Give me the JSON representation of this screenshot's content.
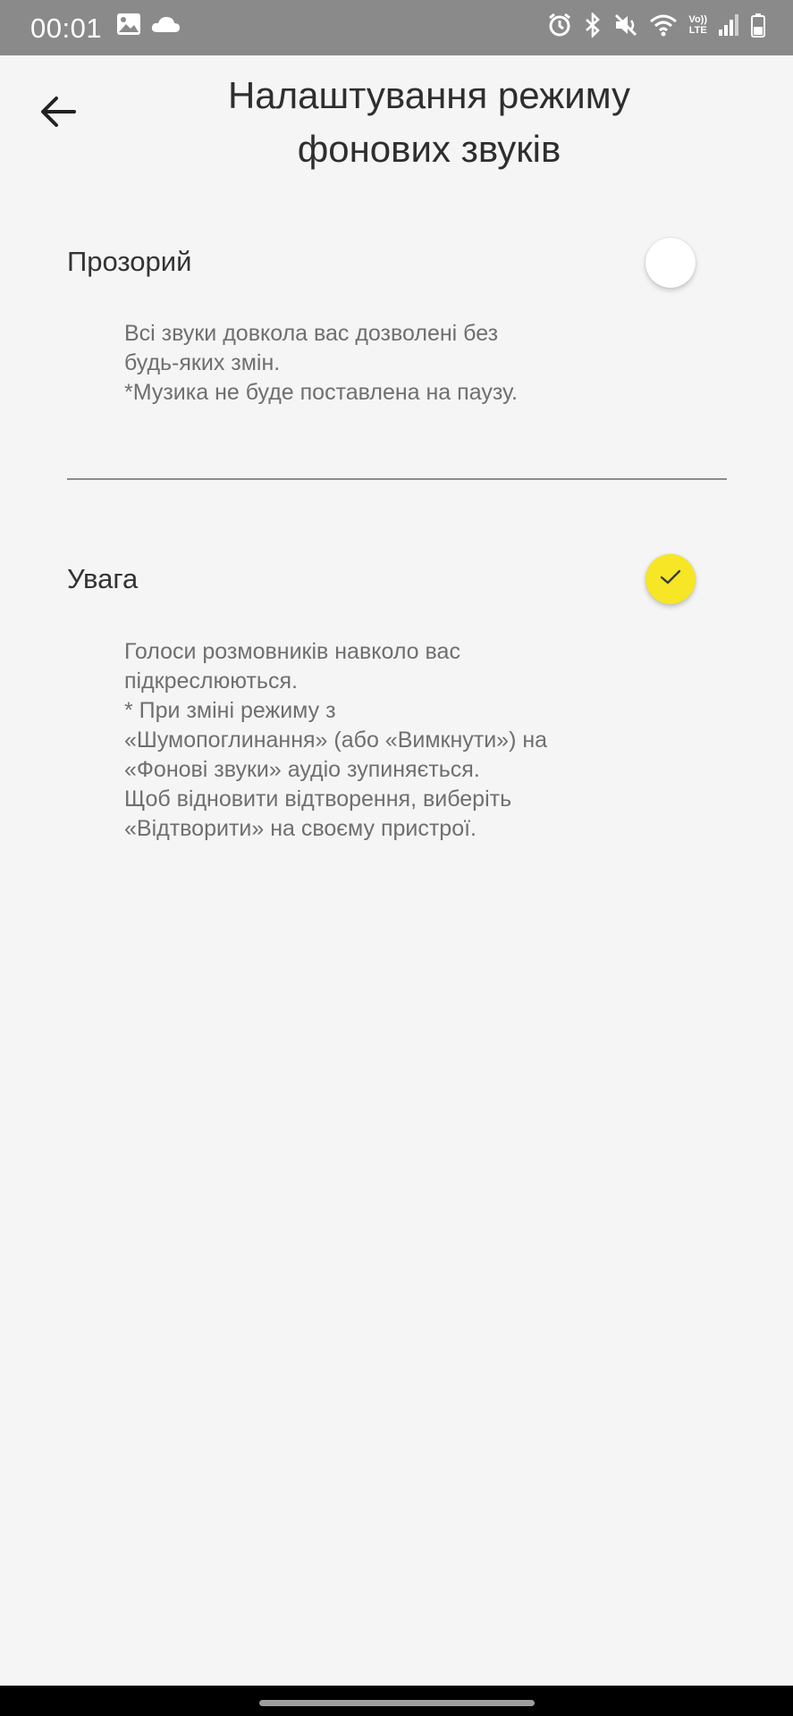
{
  "status_bar": {
    "time": "00:01",
    "icons_left": [
      "image-icon",
      "cloud-icon"
    ],
    "icons_right": [
      "alarm-icon",
      "bluetooth-icon",
      "mute-icon",
      "wifi-icon",
      "volte-icon",
      "signal-icon",
      "battery-icon"
    ],
    "volte_label_top": "Vo))",
    "volte_label_bottom": "LTE"
  },
  "header": {
    "title": "Налаштування режиму фонових звуків",
    "back_icon": "arrow-left-icon"
  },
  "options": [
    {
      "title": "Прозорий",
      "description": "Всі звуки довкола вас дозволені без\nбудь-яких змін.\n*Музика не буде поставлена на паузу.",
      "selected": false
    },
    {
      "title": "Увага",
      "description": "Голоси розмовників навколо вас\nпідкреслюються.\n* При зміні режиму з\n«Шумопоглинання» (або «Вимкнути») на\n«Фонові звуки» аудіо зупиняється.\nЩоб відновити відтворення, виберіть\n«Відтворити» на своєму пристрої.",
      "selected": true
    }
  ],
  "colors": {
    "accent": "#f6e626",
    "background": "#f5f5f5",
    "status_bar": "#8a8a8a"
  }
}
